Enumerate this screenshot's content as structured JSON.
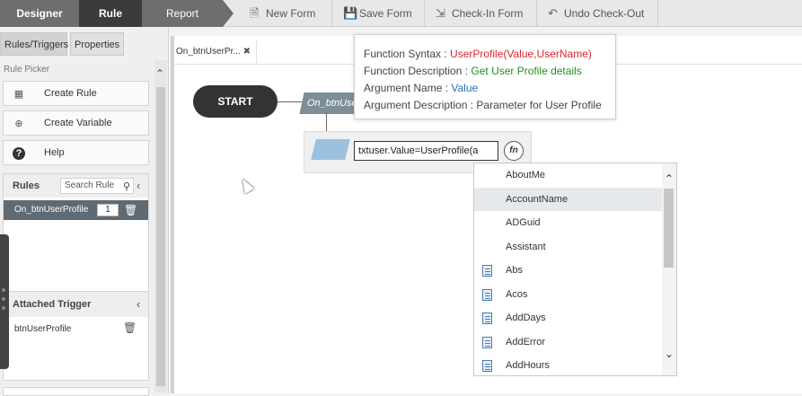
{
  "topbar": {
    "tabs": [
      "Designer",
      "Rule",
      "Report"
    ],
    "buttons": [
      {
        "label": "New Form",
        "icon": "document-icon"
      },
      {
        "label": "Save Form",
        "icon": "save-icon"
      },
      {
        "label": "Check-In Form",
        "icon": "check-in-icon"
      },
      {
        "label": "Undo Check-Out",
        "icon": "undo-icon"
      }
    ]
  },
  "leftpanel": {
    "tabs": [
      "Rules/Triggers",
      "Properties"
    ],
    "rule_picker_label": "Rule Picker",
    "picker_buttons": [
      "Create Rule",
      "Create Variable",
      "Help"
    ],
    "rules": {
      "title": "Rules",
      "search_placeholder": "Search Rule",
      "items": [
        {
          "name": "On_btnUserProfile",
          "count": "1"
        }
      ]
    },
    "trigger": {
      "title": "Attached Trigger",
      "items": [
        "btnUserProfile"
      ]
    }
  },
  "canvas": {
    "doc_tab": "On_btnUserPr...",
    "start_label": "START",
    "event_label": "On_btnUserProfile",
    "expression": "txtuser.Value=UserProfile(a",
    "fn_label": "fn"
  },
  "tooltip": {
    "syntax_label": "Function Syntax : ",
    "syntax_value": "UserProfile(Value,UserName)",
    "desc_label": "Function Description : ",
    "desc_value": "Get User Profile details",
    "arg_label": "Argument Name : ",
    "arg_value": "Value",
    "argdesc_label": "Argument Description : ",
    "argdesc_value": "Parameter for User Profile"
  },
  "autocomplete": {
    "items": [
      {
        "label": "AboutMe",
        "icon": false,
        "selected": false
      },
      {
        "label": "AccountName",
        "icon": false,
        "selected": true
      },
      {
        "label": "ADGuid",
        "icon": false,
        "selected": false
      },
      {
        "label": "Assistant",
        "icon": false,
        "selected": false
      },
      {
        "label": "Abs",
        "icon": true,
        "selected": false
      },
      {
        "label": "Acos",
        "icon": true,
        "selected": false
      },
      {
        "label": "AddDays",
        "icon": true,
        "selected": false
      },
      {
        "label": "AddError",
        "icon": true,
        "selected": false
      },
      {
        "label": "AddHours",
        "icon": true,
        "selected": false
      }
    ]
  },
  "colors": {
    "accent_dark": "#3b3b3b",
    "rule_row": "#5f6a73",
    "syntax_red": "#d9262b",
    "desc_green": "#24901f",
    "arg_blue": "#2e6fbf"
  }
}
